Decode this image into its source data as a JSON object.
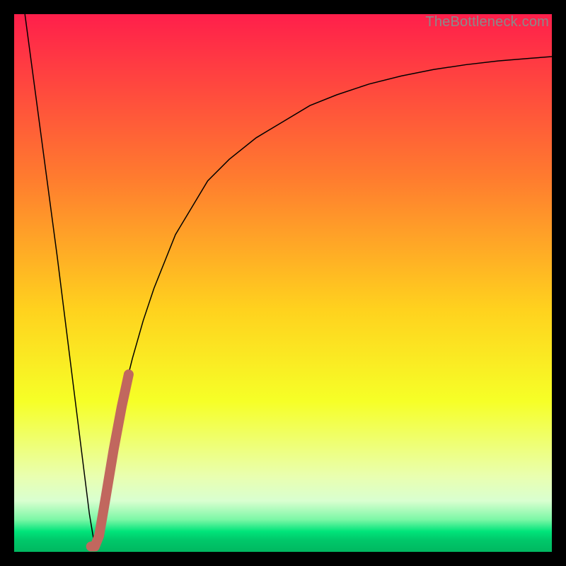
{
  "watermark": "TheBottleneck.com",
  "chart_data": {
    "type": "line",
    "title": "",
    "xlabel": "",
    "ylabel": "",
    "xlim": [
      0,
      100
    ],
    "ylim": [
      0,
      100
    ],
    "grid": false,
    "legend": false,
    "series": [
      {
        "name": "bottleneck-curve",
        "color": "#000000",
        "stroke_width": 1.5,
        "x": [
          2,
          4,
          6,
          8,
          10,
          12,
          13,
          14,
          15,
          16,
          18,
          20,
          22,
          24,
          26,
          28,
          30,
          33,
          36,
          40,
          45,
          50,
          55,
          60,
          66,
          72,
          78,
          84,
          90,
          96,
          100
        ],
        "y": [
          100,
          85,
          70,
          55,
          39,
          23,
          15,
          7,
          1,
          7,
          18,
          28,
          36,
          43,
          49,
          54,
          59,
          64,
          69,
          73,
          77,
          80,
          83,
          85,
          87,
          88.5,
          89.7,
          90.6,
          91.3,
          91.8,
          92.1
        ]
      },
      {
        "name": "highlight-segment",
        "color": "#c1675e",
        "stroke_width": 14,
        "x": [
          14.3,
          15.0,
          15.8,
          17.0,
          18.5,
          20.0,
          21.3
        ],
        "y": [
          1.0,
          1.0,
          3.0,
          10.0,
          19.0,
          27.0,
          33.0
        ]
      }
    ],
    "background_gradient": {
      "type": "vertical",
      "stops": [
        {
          "offset": 0.0,
          "color": "#ff1f4b"
        },
        {
          "offset": 0.3,
          "color": "#ff7a2f"
        },
        {
          "offset": 0.55,
          "color": "#ffd21e"
        },
        {
          "offset": 0.72,
          "color": "#f6ff27"
        },
        {
          "offset": 0.86,
          "color": "#e9ffb0"
        },
        {
          "offset": 0.905,
          "color": "#d9ffd0"
        },
        {
          "offset": 0.94,
          "color": "#7cf7a6"
        },
        {
          "offset": 0.962,
          "color": "#00e47a"
        },
        {
          "offset": 0.978,
          "color": "#00c86a"
        },
        {
          "offset": 1.0,
          "color": "#00b860"
        }
      ]
    }
  }
}
